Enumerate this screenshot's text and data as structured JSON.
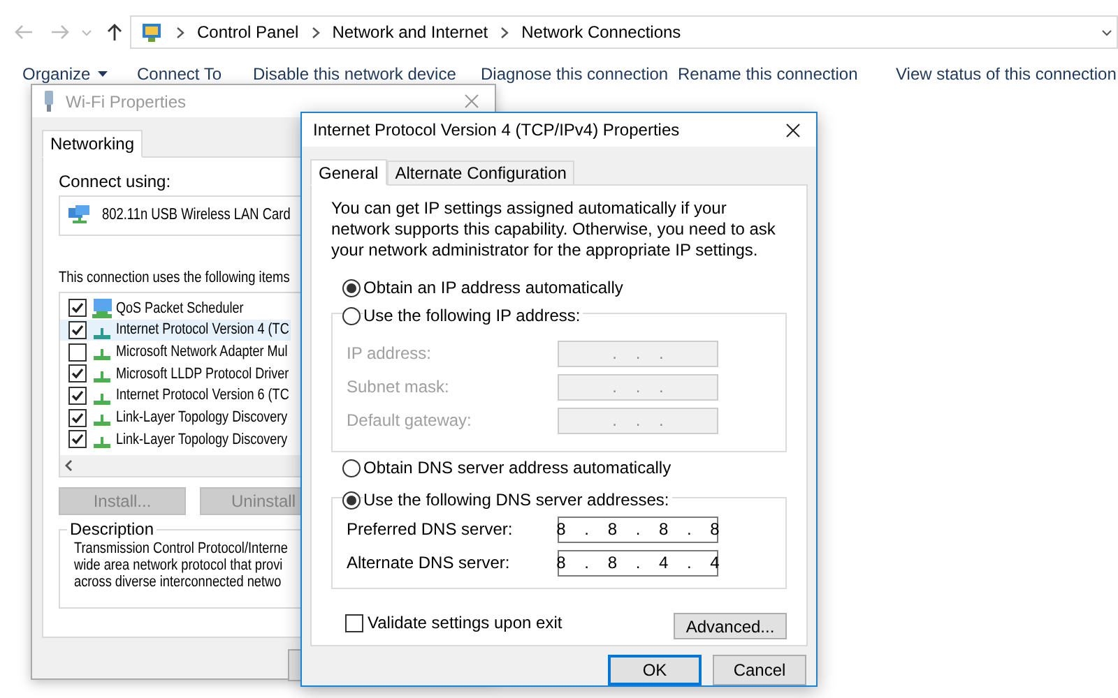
{
  "explorer": {
    "breadcrumbs": [
      "Control Panel",
      "Network and Internet",
      "Network Connections"
    ],
    "toolbar": [
      {
        "label": "Organize",
        "kind": "menu"
      },
      {
        "label": "Connect To",
        "kind": "command"
      },
      {
        "label": "Disable this network device",
        "kind": "command"
      },
      {
        "label": "Diagnose this connection",
        "kind": "command"
      },
      {
        "label": "Rename this connection",
        "kind": "command"
      },
      {
        "label": "View status of this connection",
        "kind": "command"
      }
    ]
  },
  "wifi_properties": {
    "title": "Wi-Fi Properties",
    "active": false,
    "tabs": [
      {
        "label": "Networking",
        "selected": true
      }
    ],
    "connect_using_label": "Connect using:",
    "adapter": "802.11n USB Wireless LAN Card",
    "items_label": "This connection uses the following items",
    "items": [
      {
        "label": "QoS Packet Scheduler",
        "kind": "service",
        "checked": true,
        "selected": false
      },
      {
        "label": "Internet Protocol Version 4 (TC",
        "kind": "protocol",
        "checked": true,
        "selected": true
      },
      {
        "label": "Microsoft Network Adapter Mul",
        "kind": "protocol",
        "checked": false,
        "selected": false
      },
      {
        "label": "Microsoft LLDP Protocol Driver",
        "kind": "protocol",
        "checked": true,
        "selected": false
      },
      {
        "label": "Internet Protocol Version 6 (TC",
        "kind": "protocol",
        "checked": true,
        "selected": false
      },
      {
        "label": "Link-Layer Topology Discovery",
        "kind": "protocol",
        "checked": true,
        "selected": false
      },
      {
        "label": "Link-Layer Topology Discovery",
        "kind": "protocol",
        "checked": true,
        "selected": false
      }
    ],
    "buttons": [
      {
        "label": "Install...",
        "disabled": true
      },
      {
        "label": "Uninstall",
        "disabled": true
      }
    ],
    "description_title": "Description",
    "description_lines": [
      "Transmission Control Protocol/Interne",
      "wide area network protocol that provi",
      "across diverse interconnected netwo"
    ]
  },
  "ipv4_properties": {
    "title": "Internet Protocol Version 4 (TCP/IPv4) Properties",
    "active": true,
    "tabs": [
      {
        "label": "General",
        "selected": true
      },
      {
        "label": "Alternate Configuration",
        "selected": false
      }
    ],
    "intro": "You can get IP settings assigned automatically if your network supports this capability. Otherwise, you need to ask your network administrator for the appropriate IP settings.",
    "ip_options": [
      {
        "label": "Obtain an IP address automatically",
        "selected": true
      },
      {
        "label": "Use the following IP address:",
        "selected": false
      }
    ],
    "ip_fields": [
      {
        "label": "IP address:",
        "value": ". . .",
        "disabled": true
      },
      {
        "label": "Subnet mask:",
        "value": ". . .",
        "disabled": true
      },
      {
        "label": "Default gateway:",
        "value": ". . .",
        "disabled": true
      }
    ],
    "dns_options": [
      {
        "label": "Obtain DNS server address automatically",
        "selected": false
      },
      {
        "label": "Use the following DNS server addresses:",
        "selected": true
      }
    ],
    "dns_fields": [
      {
        "label": "Preferred DNS server:",
        "value": "8 . 8 . 8 . 8",
        "disabled": false
      },
      {
        "label": "Alternate DNS server:",
        "value": "8 . 8 . 4 . 4",
        "disabled": false
      }
    ],
    "validate": {
      "label": "Validate settings upon exit",
      "checked": false
    },
    "advanced_button": "Advanced...",
    "buttons": [
      {
        "label": "OK",
        "default": true
      },
      {
        "label": "Cancel",
        "default": false
      }
    ]
  }
}
